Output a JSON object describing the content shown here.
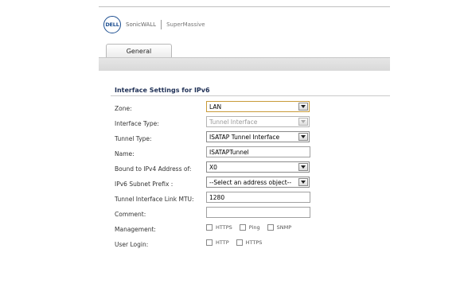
{
  "header": {
    "logo_text": "DELL",
    "brand": "SonicWALL",
    "product": "SuperMassive"
  },
  "tabs": [
    {
      "label": "General"
    }
  ],
  "section": {
    "title": "Interface Settings for IPv6"
  },
  "fields": {
    "zone": {
      "label": "Zone:",
      "value": "LAN"
    },
    "interface_type": {
      "label": "Interface Type:",
      "value": "Tunnel Interface"
    },
    "tunnel_type": {
      "label": "Tunnel Type:",
      "value": "ISATAP Tunnel Interface"
    },
    "name": {
      "label": "Name:",
      "value": "ISATAPTunnel"
    },
    "bound_ipv4": {
      "label": "Bound to IPv4 Address of:",
      "value": "X0"
    },
    "subnet_prefix": {
      "label": "IPv6 Subnet Prefix :",
      "value": "--Select an address object--"
    },
    "mtu": {
      "label": "Tunnel Interface Link MTU:",
      "value": "1280"
    },
    "comment": {
      "label": "Comment:",
      "value": ""
    }
  },
  "management": {
    "label": "Management:",
    "options": [
      "HTTPS",
      "Ping",
      "SNMP"
    ]
  },
  "user_login": {
    "label": "User Login:",
    "options": [
      "HTTP",
      "HTTPS"
    ]
  }
}
